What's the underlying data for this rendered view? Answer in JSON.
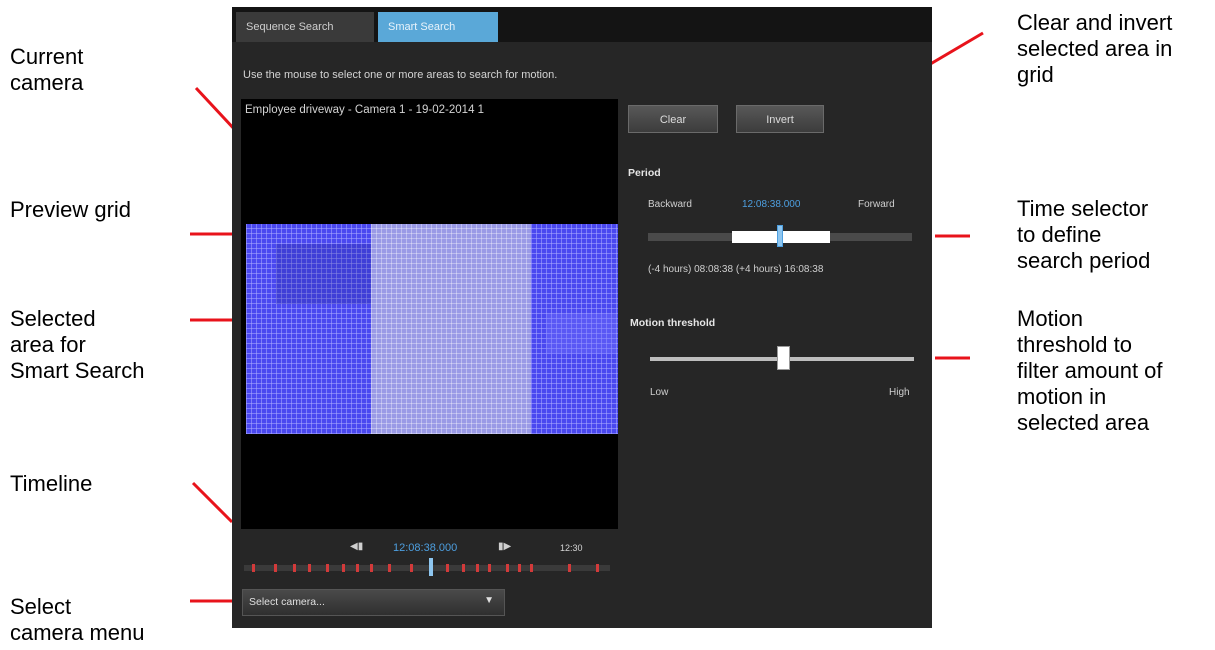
{
  "annotations": {
    "current_camera": [
      "Current",
      "camera"
    ],
    "preview_grid": "Preview grid",
    "selected_area": [
      "Selected",
      "area for",
      "Smart Search"
    ],
    "timeline": "Timeline",
    "select_camera_menu": [
      "Select",
      "camera menu"
    ],
    "clear_invert": [
      "Clear and invert",
      "selected area in",
      "grid"
    ],
    "time_selector": [
      "Time selector",
      "to define",
      "search period"
    ],
    "motion_threshold": [
      "Motion",
      "threshold to",
      "filter amount of",
      "motion in",
      "selected area"
    ]
  },
  "tabs": [
    "Sequence Search",
    "Smart Search"
  ],
  "active_tab": "Smart Search",
  "instruction": "Use the mouse to select one or more areas to search for motion.",
  "camera_title": "Employee driveway - Camera 1 - 19-02-2014 1",
  "buttons": {
    "clear": "Clear",
    "invert": "Invert"
  },
  "period": {
    "title": "Period",
    "backward": "Backward",
    "current": "12:08:38.000",
    "forward": "Forward",
    "range_text": "(-4 hours) 08:08:38 (+4 hours) 16:08:38"
  },
  "motion": {
    "title": "Motion threshold",
    "low": "Low",
    "high": "High",
    "level": 0.5
  },
  "timeline": {
    "time": "12:08:38.000",
    "end_label": "12:30"
  },
  "select_camera": {
    "label": "Select camera..."
  },
  "colors": {
    "annotation_line": "#e8131b",
    "grid_blue": "#4a48f0",
    "selected_area": "#9a9ae6",
    "accent_blue": "#4d9fe0",
    "active_tab": "#5aa8d8",
    "panel": "#262626"
  },
  "icons": {
    "prev": "previous-arrow-icon",
    "next": "next-arrow-icon",
    "dropdown": "chevron-down-icon"
  }
}
